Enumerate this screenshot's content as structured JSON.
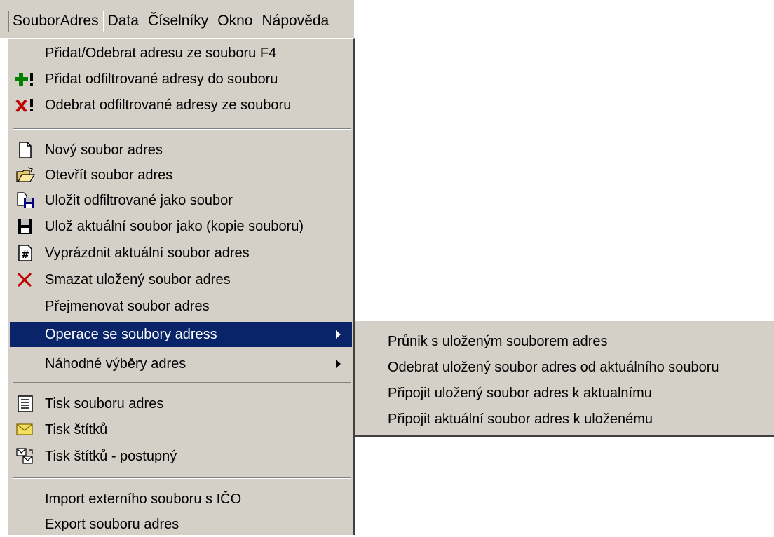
{
  "menubar": {
    "items": [
      {
        "label": "SouborAdres",
        "active": true
      },
      {
        "label": "Data"
      },
      {
        "label": "Číselníky"
      },
      {
        "label": "Okno"
      },
      {
        "label": "Nápověda"
      }
    ]
  },
  "menu": {
    "items": [
      {
        "label": "Přidat/Odebrat adresu ze souboru  F4",
        "icon": "none"
      },
      {
        "label": "Přidat odfiltrované adresy do souboru",
        "icon": "add-filtered-icon"
      },
      {
        "label": "Odebrat odfiltrované adresy ze souboru",
        "icon": "remove-filtered-icon"
      },
      {
        "label": "Nový soubor adres",
        "icon": "new-file-icon"
      },
      {
        "label": "Otevřít soubor adres",
        "icon": "open-folder-icon"
      },
      {
        "label": "Uložit odfiltrované jako soubor",
        "icon": "save-filtered-icon"
      },
      {
        "label": "Ulož aktuální soubor jako  (kopie souboru)",
        "icon": "floppy-disk-icon"
      },
      {
        "label": "Vyprázdnit aktuální soubor adres",
        "icon": "empty-file-icon"
      },
      {
        "label": "Smazat uložený soubor adres",
        "icon": "delete-x-icon"
      },
      {
        "label": "Přejmenovat soubor adres",
        "icon": "none"
      },
      {
        "label": "Operace se soubory adress",
        "icon": "none",
        "submenu": true,
        "highlighted": true
      },
      {
        "label": "Náhodné výběry adres",
        "icon": "none",
        "submenu": true
      },
      {
        "label": "Tisk souboru adres",
        "icon": "print-document-icon"
      },
      {
        "label": "Tisk štítků",
        "icon": "envelope-icon"
      },
      {
        "label": "Tisk štítků - postupný",
        "icon": "envelope-sequence-icon"
      },
      {
        "label": "Import externího souboru s IČO",
        "icon": "none"
      },
      {
        "label": "Export souboru adres",
        "icon": "none"
      }
    ]
  },
  "submenu": {
    "items": [
      {
        "label": "Průnik s uloženým souborem adres"
      },
      {
        "label": "Odebrat uložený soubor adres od aktuálního souboru"
      },
      {
        "label": "Připojit uložený soubor adres k aktualnímu"
      },
      {
        "label": "Připojit aktuální soubor adres k uloženému"
      }
    ]
  },
  "colors": {
    "menu_bg": "#d4d0c8",
    "highlight": "#0a246a",
    "green_plus": "#008000",
    "red_x": "#c00000"
  }
}
